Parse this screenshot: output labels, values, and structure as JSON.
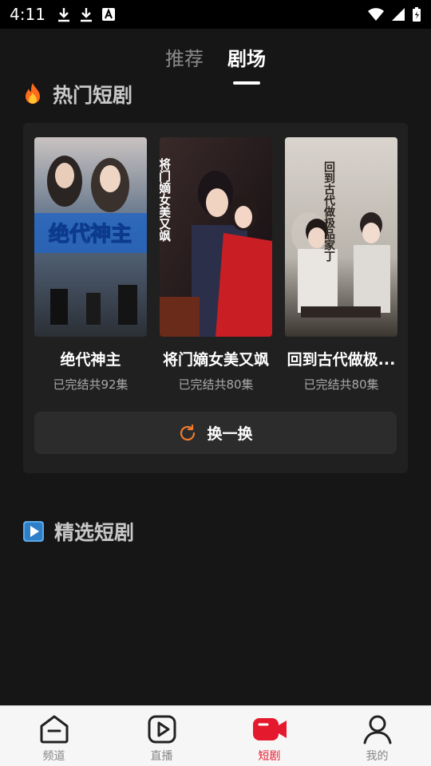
{
  "status": {
    "time": "4:11"
  },
  "tabs": [
    {
      "label": "推荐",
      "active": false
    },
    {
      "label": "剧场",
      "active": true
    }
  ],
  "hot_section": {
    "title": "热门短剧",
    "icon": "fire-icon"
  },
  "dramas": [
    {
      "title": "绝代神主",
      "status": "已完结共92集",
      "poster_text": "绝代神主"
    },
    {
      "title": "将门嫡女美又飒",
      "status": "已完结共80集",
      "poster_text": "将门嫡女美又飒"
    },
    {
      "title": "回到古代做极...",
      "status": "已完结共80集",
      "poster_text": "回到古代做极品家丁"
    }
  ],
  "refresh_button": {
    "label": "换一换",
    "icon": "refresh-icon",
    "accent": "#f07b2c"
  },
  "picked_section": {
    "title": "精选短剧",
    "icon": "play-square-icon"
  },
  "bottom_nav": [
    {
      "label": "频道",
      "icon": "channel-icon",
      "active": false
    },
    {
      "label": "直播",
      "icon": "live-play-icon",
      "active": false
    },
    {
      "label": "短剧",
      "icon": "video-camera-icon",
      "active": true
    },
    {
      "label": "我的",
      "icon": "profile-icon",
      "active": false
    }
  ],
  "colors": {
    "active_nav": "#e5192e",
    "accent": "#f07b2c"
  }
}
